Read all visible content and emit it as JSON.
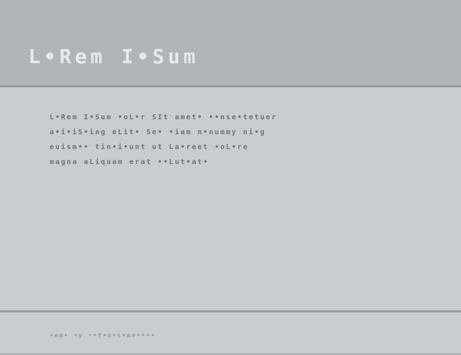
{
  "header": {
    "title": "L•Rem I•Sum"
  },
  "main": {
    "body": "L•Rem I•Sum •oL•r SIt amet• ••nse•tetuer\na•i•iS•ing eLit• Se• •iam n•nummy ni•g\neuism•• tin•i•unt ut La•reet •oL•re\nmagna aLiquam erat ••Lut•at•"
  },
  "footer": {
    "text": "•em• •y ••f•n•s•ne••••"
  }
}
